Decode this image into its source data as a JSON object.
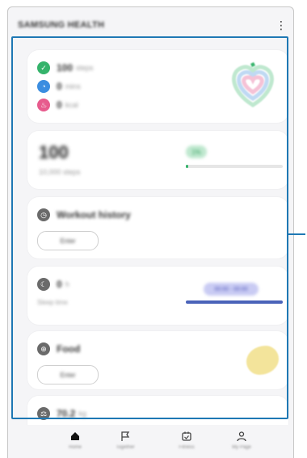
{
  "app": {
    "title": "SAMSUNG HEALTH",
    "more_icon": "more-vertical-icon"
  },
  "summary": {
    "items": [
      {
        "icon": "footsteps-icon",
        "value": "100",
        "unit": "steps",
        "color": "#35b36b"
      },
      {
        "icon": "clock-icon",
        "value": "0",
        "unit": "mins",
        "color": "#3b8de0"
      },
      {
        "icon": "flame-icon",
        "value": "0",
        "unit": "kcal",
        "color": "#e75b8d"
      }
    ]
  },
  "steps": {
    "count": "100",
    "target": "10,000 steps",
    "progress_percent": 1,
    "percent_label": "1%"
  },
  "workout": {
    "title": "Workout history",
    "button": "Enter"
  },
  "sleep": {
    "value": "0",
    "unit": "h",
    "label": "Sleep time",
    "pill": "00:00 - 00:00"
  },
  "food": {
    "title": "Food",
    "button": "Enter"
  },
  "weight": {
    "value": "70.2",
    "unit": "kg"
  },
  "nav": [
    {
      "label": "Home",
      "icon": "home-icon",
      "active": true
    },
    {
      "label": "Together",
      "icon": "flag-icon",
      "active": false
    },
    {
      "label": "Fitness",
      "icon": "calendar-icon",
      "active": false
    },
    {
      "label": "My Page",
      "icon": "person-icon",
      "active": false
    }
  ],
  "colors": {
    "accent": "#1e78b4",
    "steps_green": "#35b36b",
    "sleep_blue": "#4a63b9"
  }
}
